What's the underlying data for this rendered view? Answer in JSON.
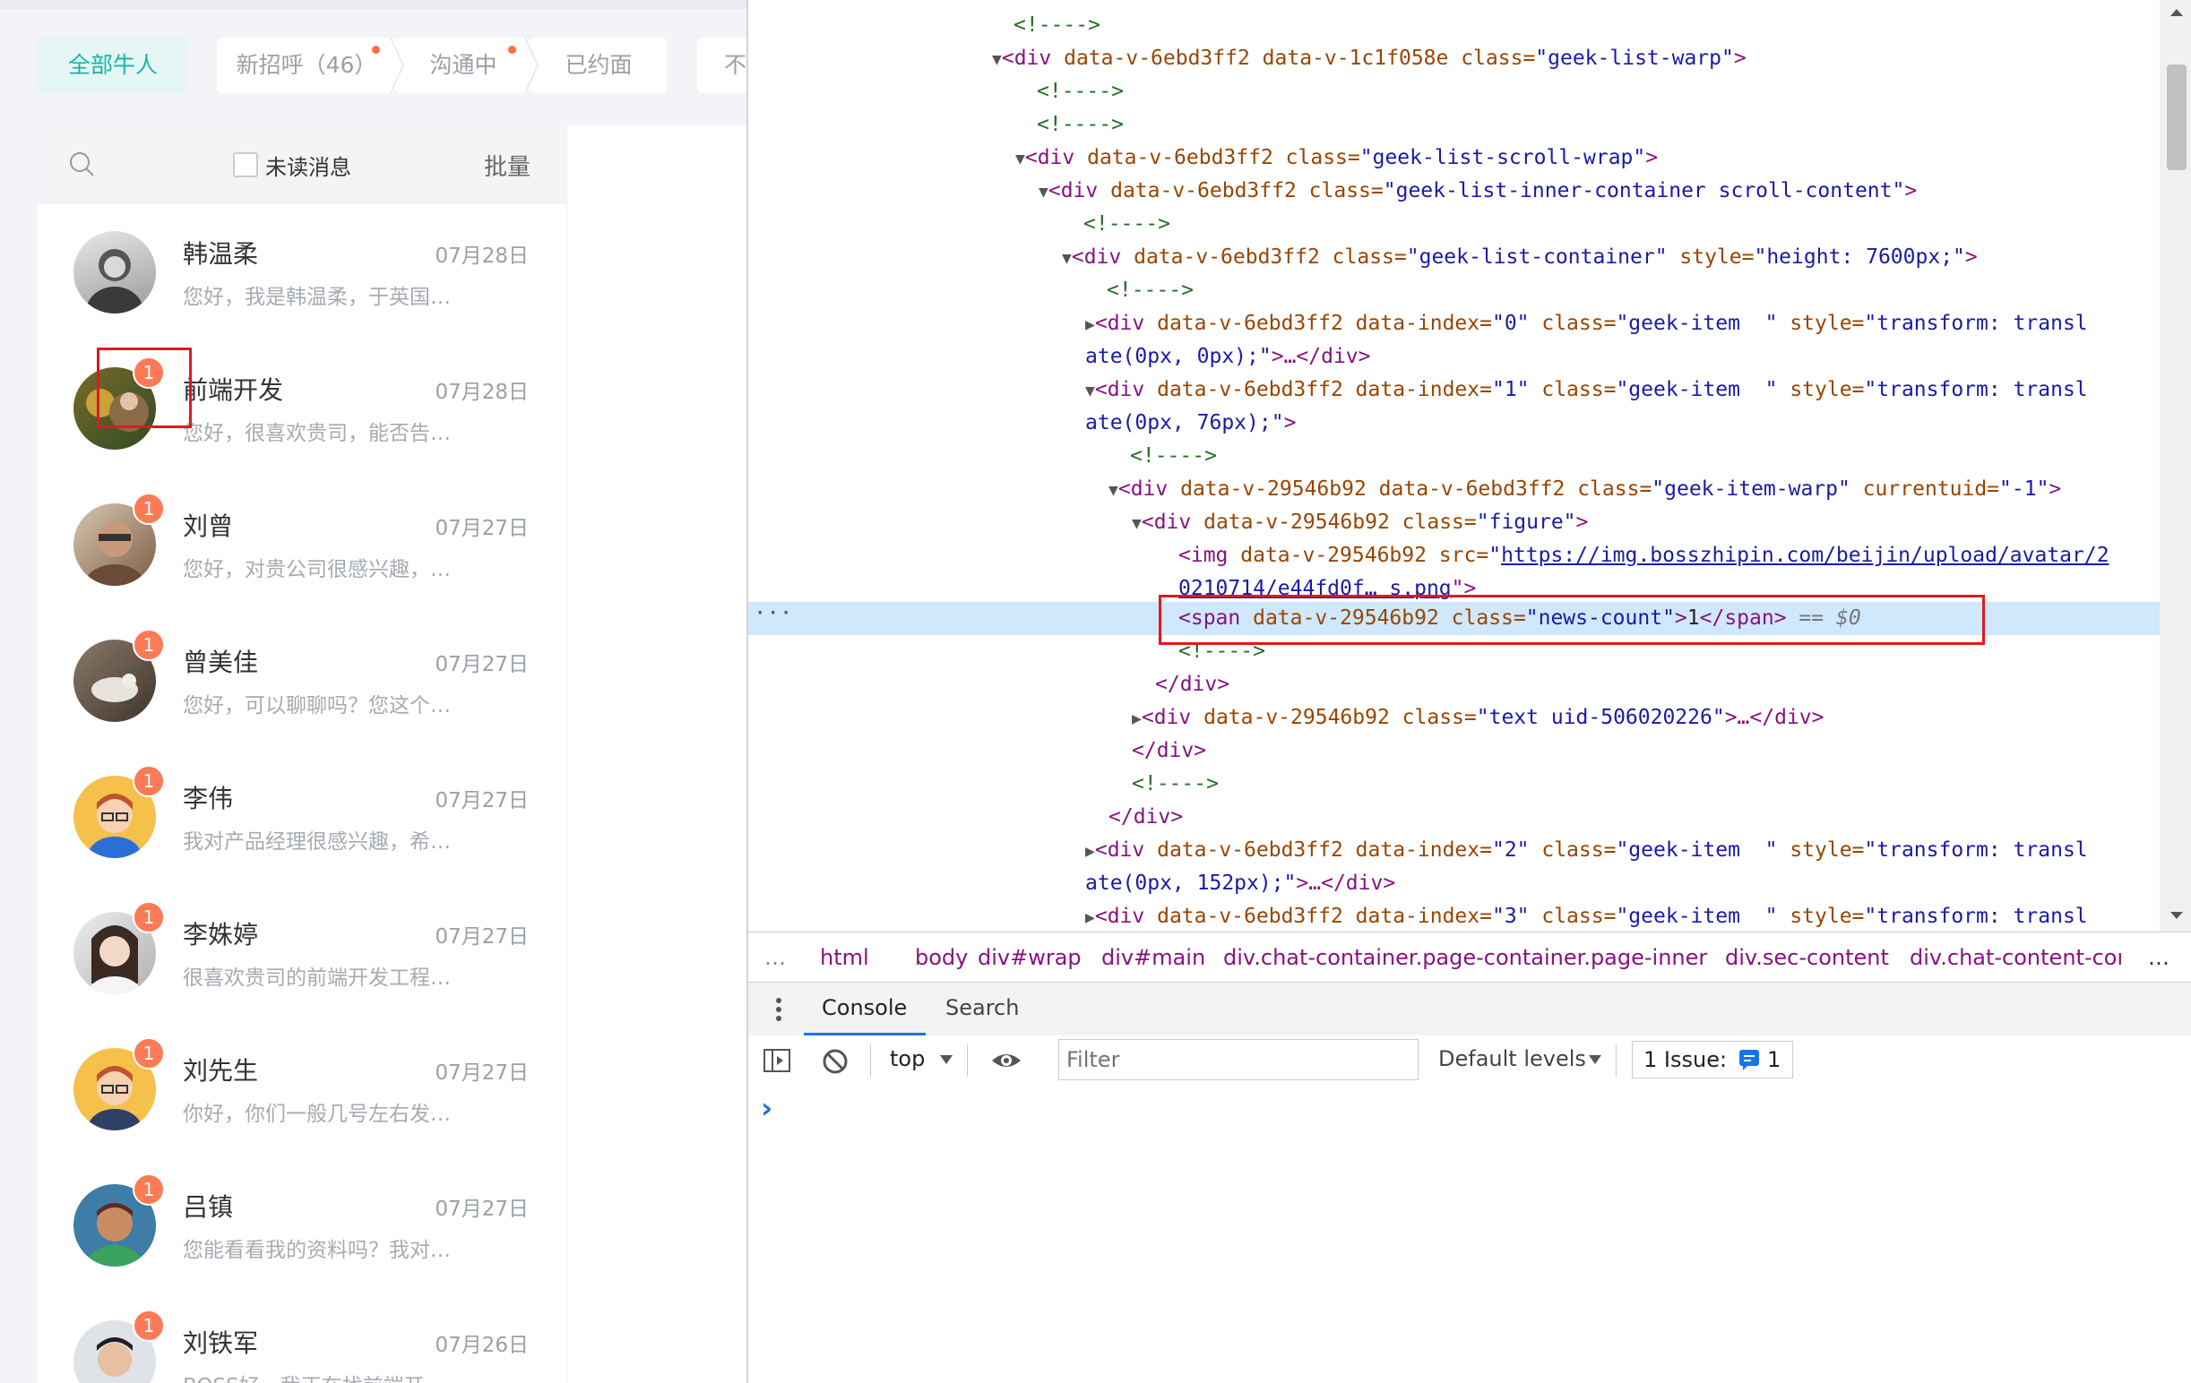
{
  "filters": {
    "all": "全部牛人",
    "new_greeting": "新招呼（46）",
    "communicating": "沟通中",
    "interviewed": "已约面",
    "truncated": "不"
  },
  "list_header": {
    "unread_label": "未读消息",
    "batch_label": "批量"
  },
  "conversations": [
    {
      "name": "韩温柔",
      "date": "07月28日",
      "preview": "您好，我是韩温柔，于英国…",
      "badge": ""
    },
    {
      "name": "前端开发",
      "date": "07月28日",
      "preview": "您好，很喜欢贵司，能否告…",
      "badge": "1"
    },
    {
      "name": "刘曾",
      "date": "07月27日",
      "preview": "您好，对贵公司很感兴趣，…",
      "badge": "1"
    },
    {
      "name": "曾美佳",
      "date": "07月27日",
      "preview": "您好，可以聊聊吗？您这个…",
      "badge": "1"
    },
    {
      "name": "李伟",
      "date": "07月27日",
      "preview": "我对产品经理很感兴趣，希…",
      "badge": "1"
    },
    {
      "name": "李姝婷",
      "date": "07月27日",
      "preview": "很喜欢贵司的前端开发工程…",
      "badge": "1"
    },
    {
      "name": "刘先生",
      "date": "07月27日",
      "preview": "你好，你们一般几号左右发…",
      "badge": "1"
    },
    {
      "name": "吕镇",
      "date": "07月27日",
      "preview": "您能看看我的资料吗？我对…",
      "badge": "1"
    },
    {
      "name": "刘铁军",
      "date": "07月26日",
      "preview": "BOSS好，我正在找前端开…",
      "badge": "1"
    }
  ],
  "devtools": {
    "code": {
      "l0": "<!---->",
      "l1_tag": "<div ",
      "l1_attrs": "data-v-6ebd3ff2 data-v-1c1f058e ",
      "l1_class": "class=",
      "l1_val": "\"geek-list-warp\"",
      "l1_end": ">",
      "l2": "<!---->",
      "l3": "<!---->",
      "l4_tag": "<div ",
      "l4_attrs": "data-v-6ebd3ff2 ",
      "l4_class": "class=",
      "l4_val": "\"geek-list-scroll-wrap\"",
      "l4_end": ">",
      "l5_tag": "<div ",
      "l5_attrs": "data-v-6ebd3ff2 ",
      "l5_class": "class=",
      "l5_val": "\"geek-list-inner-container scroll-content\"",
      "l5_end": ">",
      "l6": "<!---->",
      "l7_tag": "<div ",
      "l7_attrs": "data-v-6ebd3ff2 ",
      "l7_class": "class=",
      "l7_val": "\"geek-list-container\"",
      "l7_style": " style=",
      "l7_styleval": "\"height: 7600px;\"",
      "l7_end": ">",
      "l8": "<!---->",
      "l9_tag": "<div ",
      "l9_attrs": "data-v-6ebd3ff2 data-index=",
      "l9_idx": "\"0\"",
      "l9_class": " class=",
      "l9_val": "\"geek-item  \"",
      "l9_style": " style=",
      "l9_sv": "\"transform: transl",
      "l10_sv": "ate(0px, 0px);\"",
      "l10_end": ">…</div>",
      "l11_tag": "<div ",
      "l11_attrs": "data-v-6ebd3ff2 data-index=",
      "l11_idx": "\"1\"",
      "l11_class": " class=",
      "l11_val": "\"geek-item  \"",
      "l11_style": " style=",
      "l11_sv": "\"transform: transl",
      "l12_sv": "ate(0px, 76px);\"",
      "l12_end": ">",
      "l13": "<!---->",
      "l14_tag": "<div ",
      "l14_attrs": "data-v-29546b92 data-v-6ebd3ff2 ",
      "l14_class": "class=",
      "l14_val": "\"geek-item-warp\"",
      "l14_cu": " currentuid=",
      "l14_cuv": "\"-1\"",
      "l14_end": ">",
      "l15_tag": "<div ",
      "l15_attrs": "data-v-29546b92 ",
      "l15_class": "class=",
      "l15_val": "\"figure\"",
      "l15_end": ">",
      "l16_tag": "<img ",
      "l16_attrs": "data-v-29546b92 src=",
      "l16_q": "\"",
      "l16_link": "https://img.bosszhipin.com/beijin/upload/avatar/2",
      "l17_link": "0210714/e44fd0f… s.png",
      "l17_end": "\">",
      "l18_tag": "<span ",
      "l18_attrs": "data-v-29546b92 ",
      "l18_class": "class=",
      "l18_val": "\"news-count\"",
      "l18_end": ">",
      "l18_text": "1",
      "l18_close": "</span>",
      "l18_eq": " == $0",
      "l19": "<!---->",
      "l20": "</div>",
      "l21_tag": "<div ",
      "l21_attrs": "data-v-29546b92 ",
      "l21_class": "class=",
      "l21_val": "\"text uid-506020226\"",
      "l21_end": ">…</div>",
      "l22": "</div>",
      "l23": "<!---->",
      "l24": "</div>",
      "l25_tag": "<div ",
      "l25_attrs": "data-v-6ebd3ff2 data-index=",
      "l25_idx": "\"2\"",
      "l25_class": " class=",
      "l25_val": "\"geek-item  \"",
      "l25_style": " style=",
      "l25_sv": "\"transform: transl",
      "l26_sv": "ate(0px, 152px);\"",
      "l26_end": ">…</div>",
      "l27_tag": "<div ",
      "l27_attrs": "data-v-6ebd3ff2 data-index=",
      "l27_idx": "\"3\"",
      "l27_class": " class=",
      "l27_val": "\"geek-item  \"",
      "l27_style": " style=",
      "l27_sv": "\"transform: transl",
      "ellipsis": "…"
    },
    "breadcrumb": [
      "html",
      "body",
      "div#wrap",
      "div#main",
      "div.chat-container.page-container.page-inner",
      "div.sec-content",
      "div.chat-content-cont"
    ],
    "breadcrumb_more": "…",
    "console_tabs": [
      "Console",
      "Search"
    ],
    "toolbar": {
      "context": "top",
      "filter_placeholder": "Filter",
      "levels": "Default levels",
      "issues_label": "1 Issue:",
      "issues_count": "1"
    },
    "prompt": "›"
  },
  "colors": {
    "accent": "#12b8a6",
    "badge": "#fe7a55",
    "highlight_box": "#e0191f",
    "selected_row": "#cfe8fc"
  }
}
